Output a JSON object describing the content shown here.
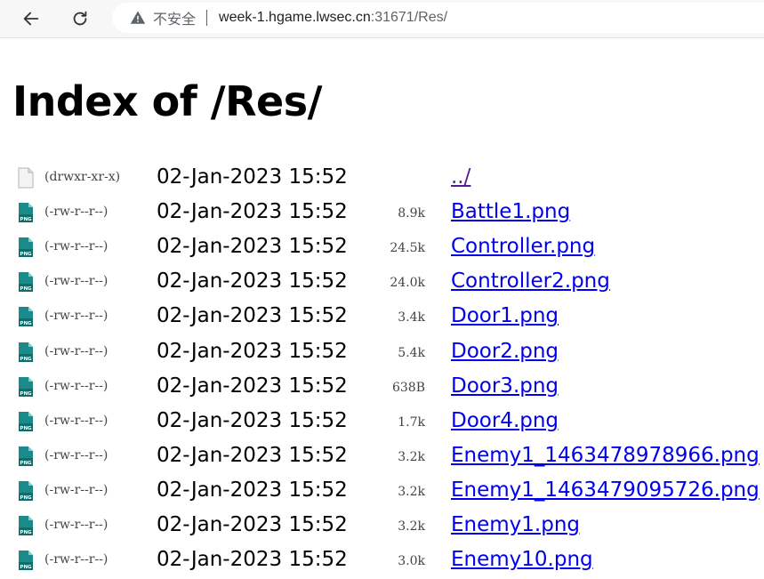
{
  "browser": {
    "security_label": "不安全",
    "url_host": "week-1.hgame.lwsec.cn",
    "url_rest": ":31671/Res/"
  },
  "page": {
    "heading": "Index of /Res/"
  },
  "entries": [
    {
      "type": "folder",
      "perm": "(drwxr-xr-x)",
      "date": "02-Jan-2023 15:52",
      "size": "",
      "name": "../"
    },
    {
      "type": "png",
      "perm": "(-rw-r--r--)",
      "date": "02-Jan-2023 15:52",
      "size": "8.9k",
      "name": "Battle1.png"
    },
    {
      "type": "png",
      "perm": "(-rw-r--r--)",
      "date": "02-Jan-2023 15:52",
      "size": "24.5k",
      "name": "Controller.png"
    },
    {
      "type": "png",
      "perm": "(-rw-r--r--)",
      "date": "02-Jan-2023 15:52",
      "size": "24.0k",
      "name": "Controller2.png"
    },
    {
      "type": "png",
      "perm": "(-rw-r--r--)",
      "date": "02-Jan-2023 15:52",
      "size": "3.4k",
      "name": "Door1.png"
    },
    {
      "type": "png",
      "perm": "(-rw-r--r--)",
      "date": "02-Jan-2023 15:52",
      "size": "5.4k",
      "name": "Door2.png"
    },
    {
      "type": "png",
      "perm": "(-rw-r--r--)",
      "date": "02-Jan-2023 15:52",
      "size": "638B",
      "name": "Door3.png"
    },
    {
      "type": "png",
      "perm": "(-rw-r--r--)",
      "date": "02-Jan-2023 15:52",
      "size": "1.7k",
      "name": "Door4.png"
    },
    {
      "type": "png",
      "perm": "(-rw-r--r--)",
      "date": "02-Jan-2023 15:52",
      "size": "3.2k",
      "name": "Enemy1_1463478978966.png"
    },
    {
      "type": "png",
      "perm": "(-rw-r--r--)",
      "date": "02-Jan-2023 15:52",
      "size": "3.2k",
      "name": "Enemy1_1463479095726.png"
    },
    {
      "type": "png",
      "perm": "(-rw-r--r--)",
      "date": "02-Jan-2023 15:52",
      "size": "3.2k",
      "name": "Enemy1.png"
    },
    {
      "type": "png",
      "perm": "(-rw-r--r--)",
      "date": "02-Jan-2023 15:52",
      "size": "3.0k",
      "name": "Enemy10.png"
    }
  ],
  "icons": {
    "back": "back-arrow-icon",
    "reload": "reload-icon",
    "warning": "warning-triangle-icon",
    "folder": "parent-dir-file-icon",
    "png": "png-file-icon"
  },
  "colors": {
    "link": "#0000ee",
    "visited": "#551a8b",
    "png_icon": "#1b8a8a"
  }
}
